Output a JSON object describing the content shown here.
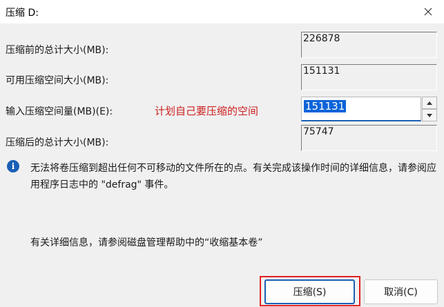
{
  "window": {
    "title": "压缩 D:",
    "close_icon": "close-icon"
  },
  "fields": {
    "total_before_label": "压缩前的总计大小(MB):",
    "total_before_value": "226878",
    "available_label": "可用压缩空间大小(MB):",
    "available_value": "151131",
    "amount_label": "输入压缩空间量(MB)(E):",
    "amount_value": "151131",
    "total_after_label": "压缩后的总计大小(MB):",
    "total_after_value": "75747"
  },
  "annotation": {
    "text": "计划自己要压缩的空间",
    "color": "#cc1f1f"
  },
  "info": {
    "icon": "info-icon",
    "text": "无法将卷压缩到超出任何不可移动的文件所在的点。有关完成该操作时间的详细信息，请参阅应用程序日志中的 \"defrag\" 事件。"
  },
  "help": {
    "text": "有关详细信息，请参阅磁盘管理帮助中的“收缩基本卷”"
  },
  "buttons": {
    "shrink_label": "压缩(S)",
    "cancel_label": "取消(C)"
  },
  "colors": {
    "accent": "#1a5fb4",
    "highlight": "#e02020",
    "selection": "#0a64d8"
  }
}
